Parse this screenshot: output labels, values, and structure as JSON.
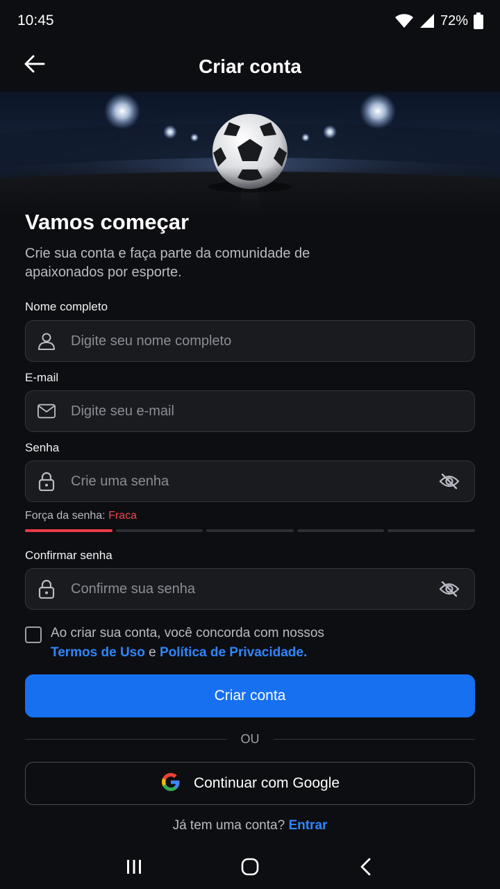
{
  "status_bar": {
    "time": "10:45",
    "battery": "72%",
    "icons": [
      "wifi-icon",
      "signal-icon",
      "battery-icon"
    ]
  },
  "app_bar": {
    "title": "Criar conta",
    "back_icon": "arrow-left-icon"
  },
  "hero": {
    "image": "soccer-ball-stadium"
  },
  "intro": {
    "headline": "Vamos começar",
    "subtitle": "Crie sua conta e faça parte da comunidade de apaixonados por esporte."
  },
  "form": {
    "name": {
      "label": "Nome completo",
      "placeholder": "Digite seu nome completo",
      "icon": "user-icon"
    },
    "email": {
      "label": "E-mail",
      "placeholder": "Digite seu e-mail",
      "icon": "mail-icon"
    },
    "password": {
      "label": "Senha",
      "placeholder": "Crie uma senha",
      "icon": "lock-icon",
      "toggle_icon": "eye-off-icon"
    },
    "strength": {
      "label": "Força da senha:",
      "value": "Fraca",
      "level": 1,
      "segments": 5
    },
    "confirm": {
      "label": "Confirmar senha",
      "placeholder": "Confirme sua senha",
      "icon": "lock-icon",
      "toggle_icon": "eye-off-icon"
    },
    "terms": {
      "text": "Ao criar sua conta, você concorda com nossos",
      "terms_link": "Termos de Uso",
      "conjunction": "e",
      "privacy_link": "Política de Privacidade."
    },
    "submit": "Criar conta"
  },
  "divider_text": "OU",
  "google": {
    "label": "Continuar com Google",
    "icon": "google-icon"
  },
  "login": {
    "text": "Já tem uma conta?",
    "link": "Entrar"
  },
  "nav": {
    "icons": [
      "recents-icon",
      "home-icon",
      "back-icon"
    ]
  },
  "colors": {
    "background": "#0d0e11",
    "primary": "#1670f0",
    "link": "#2f86ff",
    "weak": "#f0444f"
  }
}
